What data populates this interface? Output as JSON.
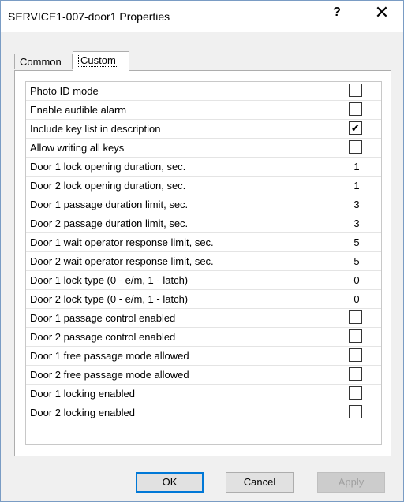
{
  "window": {
    "title": "SERVICE1-007-door1 Properties",
    "help_label": "?",
    "close_label": "✕"
  },
  "tabs": [
    {
      "label": "Common",
      "selected": false
    },
    {
      "label": "Custom",
      "selected": true
    }
  ],
  "properties": [
    {
      "label": "Photo ID mode",
      "type": "checkbox",
      "checked": false
    },
    {
      "label": "Enable audible alarm",
      "type": "checkbox",
      "checked": false
    },
    {
      "label": "Include key list in description",
      "type": "checkbox",
      "checked": true
    },
    {
      "label": "Allow writing all keys",
      "type": "checkbox",
      "checked": false
    },
    {
      "label": "Door 1 lock opening duration, sec.",
      "type": "value",
      "value": "1"
    },
    {
      "label": "Door 2 lock opening duration, sec.",
      "type": "value",
      "value": "1"
    },
    {
      "label": "Door 1 passage duration limit, sec.",
      "type": "value",
      "value": "3"
    },
    {
      "label": "Door 2 passage duration limit, sec.",
      "type": "value",
      "value": "3"
    },
    {
      "label": "Door 1 wait operator response limit, sec.",
      "type": "value",
      "value": "5"
    },
    {
      "label": "Door 2 wait operator response limit, sec.",
      "type": "value",
      "value": "5"
    },
    {
      "label": "Door 1 lock type (0 - e/m, 1 - latch)",
      "type": "value",
      "value": "0"
    },
    {
      "label": "Door 2 lock type (0 - e/m, 1 - latch)",
      "type": "value",
      "value": "0"
    },
    {
      "label": "Door 1 passage control enabled",
      "type": "checkbox",
      "checked": false
    },
    {
      "label": "Door 2 passage control enabled",
      "type": "checkbox",
      "checked": false
    },
    {
      "label": "Door 1 free passage mode allowed",
      "type": "checkbox",
      "checked": false
    },
    {
      "label": "Door 2 free passage mode allowed",
      "type": "checkbox",
      "checked": false
    },
    {
      "label": "Door 1 locking enabled",
      "type": "checkbox",
      "checked": false
    },
    {
      "label": "Door 2 locking enabled",
      "type": "checkbox",
      "checked": false
    }
  ],
  "buttons": {
    "ok_label": "OK",
    "cancel_label": "Cancel",
    "apply_label": "Apply",
    "apply_enabled": false
  },
  "colors": {
    "accent": "#0078d7",
    "window_border": "#7a9cc4"
  }
}
